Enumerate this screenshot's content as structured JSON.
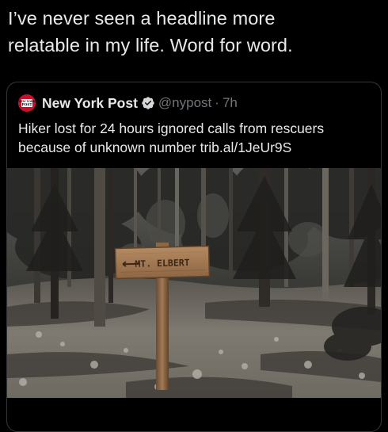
{
  "caption": {
    "line1": "I’ve never seen a headline more",
    "line2": "relatable in my life. Word for word."
  },
  "quoted_tweet": {
    "author_name": "New York Post",
    "handle": "@nypost",
    "separator": "·",
    "time": "7h",
    "avatar_text": "NEW YORK POST",
    "text_line1": "Hiker lost for 24 hours ignored calls from rescuers",
    "text_line2": "because of unknown number trib.al/1JeUr9S",
    "image": {
      "sign_text": "MT. ELBERT"
    }
  },
  "colors": {
    "background": "#000000",
    "text_primary": "#e7e9ea",
    "text_secondary": "#71767b",
    "border": "#333639",
    "brand_red": "#c8102e"
  },
  "icons": {
    "verified": "verified-badge-icon",
    "avatar": "new-york-post-logo"
  }
}
